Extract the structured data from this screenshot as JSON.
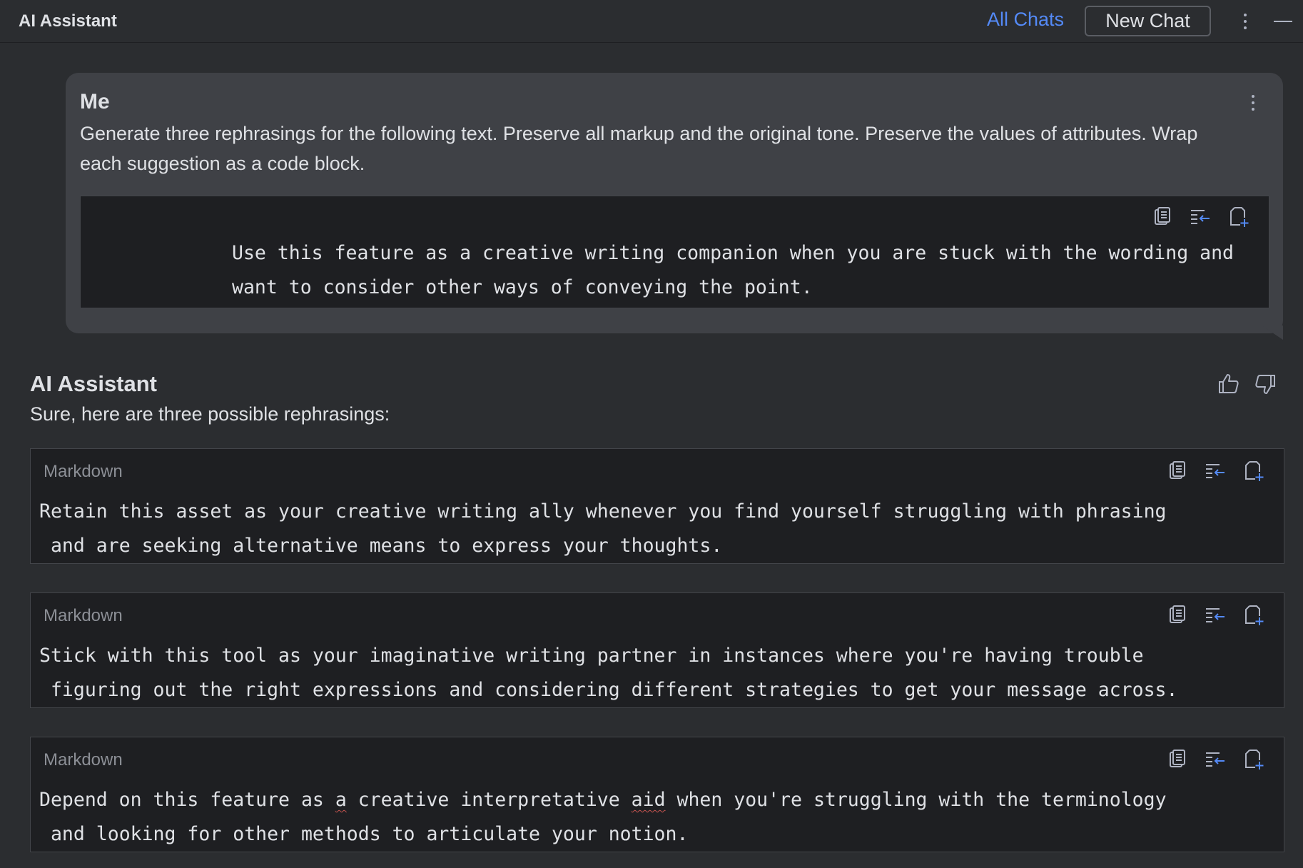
{
  "header": {
    "title": "AI Assistant",
    "all_chats": "All Chats",
    "new_chat": "New Chat"
  },
  "user_message": {
    "author": "Me",
    "text": "Generate three rephrasings for the following text. Preserve all markup and the original tone. Preserve the values of attributes. Wrap each suggestion as a code block.",
    "code": "Use this feature as a creative writing companion when you are stuck with the wording and want to consider other ways of conveying the point."
  },
  "assistant_message": {
    "author": "AI Assistant",
    "intro": "Sure, here are three possible rephrasings:",
    "blocks": [
      {
        "language": "Markdown",
        "line1": "Retain this asset as your creative writing ally whenever you find yourself struggling with phrasing",
        "line2": " and are seeking alternative means to express your thoughts."
      },
      {
        "language": "Markdown",
        "line1": "Stick with this tool as your imaginative writing partner in instances where you're having trouble",
        "line2": " figuring out the right expressions and considering different strategies to get your message across."
      },
      {
        "language": "Markdown",
        "line1_a": "Depend on this feature as ",
        "line1_b": "a",
        "line1_c": " creative interpretative ",
        "line1_d": "aid",
        "line1_e": " when you're struggling with the terminology",
        "line2": " and looking for other methods to articulate your notion."
      }
    ]
  },
  "icons": {
    "copy": "copy-icon",
    "insert": "insert-snippet-icon",
    "new_file": "new-file-icon",
    "thumbs_up": "thumbs-up-icon",
    "thumbs_down": "thumbs-down-icon",
    "more": "more-vertical-icon",
    "minimize": "minimize-icon"
  },
  "colors": {
    "background": "#2b2d30",
    "bubble": "#3f4146",
    "code_bg": "#1e1f22",
    "accent": "#548af7"
  }
}
